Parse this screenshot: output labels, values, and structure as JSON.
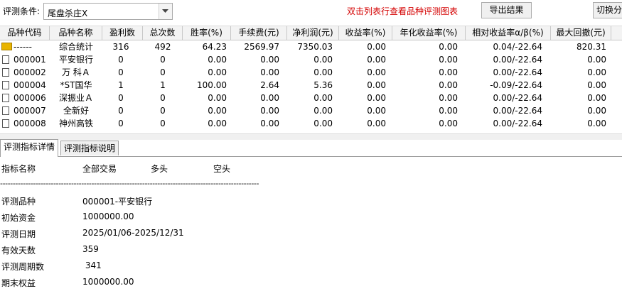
{
  "toolbar": {
    "condition_label": "评测条件:",
    "condition_value": "尾盘杀庄X",
    "hint": "双击列表行查看品种评测图表",
    "export_label": "导出结果",
    "switch_label": "切换分"
  },
  "table": {
    "columns": [
      "品种代码",
      "品种名称",
      "盈利数",
      "总次数",
      "胜率(%)",
      "手续费(元)",
      "净利润(元)",
      "收益率(%)",
      "年化收益率(%)",
      "相对收益率α/β(%)",
      "最大回撤(元)"
    ],
    "rows": [
      {
        "code": "------",
        "name": "综合统计",
        "wins": "316",
        "total": "492",
        "winrate": "64.23",
        "fee": "2569.97",
        "profit": "7350.03",
        "ret": "0.00",
        "annual": "0.00",
        "alpha": "0.04/-22.64",
        "dd": "820.31"
      },
      {
        "code": "000001",
        "name": "平安银行",
        "wins": "0",
        "total": "0",
        "winrate": "0.00",
        "fee": "0.00",
        "profit": "0.00",
        "ret": "0.00",
        "annual": "0.00",
        "alpha": "0.00/-22.64",
        "dd": "0.00"
      },
      {
        "code": "000002",
        "name": "万 科Ａ",
        "wins": "0",
        "total": "0",
        "winrate": "0.00",
        "fee": "0.00",
        "profit": "0.00",
        "ret": "0.00",
        "annual": "0.00",
        "alpha": "0.00/-22.64",
        "dd": "0.00"
      },
      {
        "code": "000004",
        "name": "*ST国华",
        "wins": "1",
        "total": "1",
        "winrate": "100.00",
        "fee": "2.64",
        "profit": "5.36",
        "ret": "0.00",
        "annual": "0.00",
        "alpha": "-0.09/-22.64",
        "dd": "0.00"
      },
      {
        "code": "000006",
        "name": "深振业Ａ",
        "wins": "0",
        "total": "0",
        "winrate": "0.00",
        "fee": "0.00",
        "profit": "0.00",
        "ret": "0.00",
        "annual": "0.00",
        "alpha": "0.00/-22.64",
        "dd": "0.00"
      },
      {
        "code": "000007",
        "name": "全新好",
        "wins": "0",
        "total": "0",
        "winrate": "0.00",
        "fee": "0.00",
        "profit": "0.00",
        "ret": "0.00",
        "annual": "0.00",
        "alpha": "0.00/-22.64",
        "dd": "0.00"
      },
      {
        "code": "000008",
        "name": "神州高铁",
        "wins": "0",
        "total": "0",
        "winrate": "0.00",
        "fee": "0.00",
        "profit": "0.00",
        "ret": "0.00",
        "annual": "0.00",
        "alpha": "0.00/-22.64",
        "dd": "0.00"
      }
    ]
  },
  "tabs": [
    "评测指标详情",
    "评测指标说明"
  ],
  "details": {
    "header": {
      "name": "指标名称",
      "all": "全部交易",
      "long": "多头",
      "short": "空头"
    },
    "separator": "------------------------------------------------------------------------------------------------------",
    "items": [
      {
        "label": "评测品种",
        "value": "000001-平安银行"
      },
      {
        "label": "初始资金",
        "value": "1000000.00"
      },
      {
        "label": "评测日期",
        "value": "2025/01/06-2025/12/31"
      },
      {
        "label": "有效天数",
        "value": "359"
      },
      {
        "label": "评测周期数",
        "value": " 341"
      },
      {
        "label": "期末权益",
        "value": "1000000.00"
      }
    ]
  },
  "colors": {
    "hint": "#d40000",
    "folder": "#e8b400"
  },
  "icons": {
    "row_summary": "folder-icon",
    "row": "document-icon",
    "combo": "chevron-down-icon"
  }
}
